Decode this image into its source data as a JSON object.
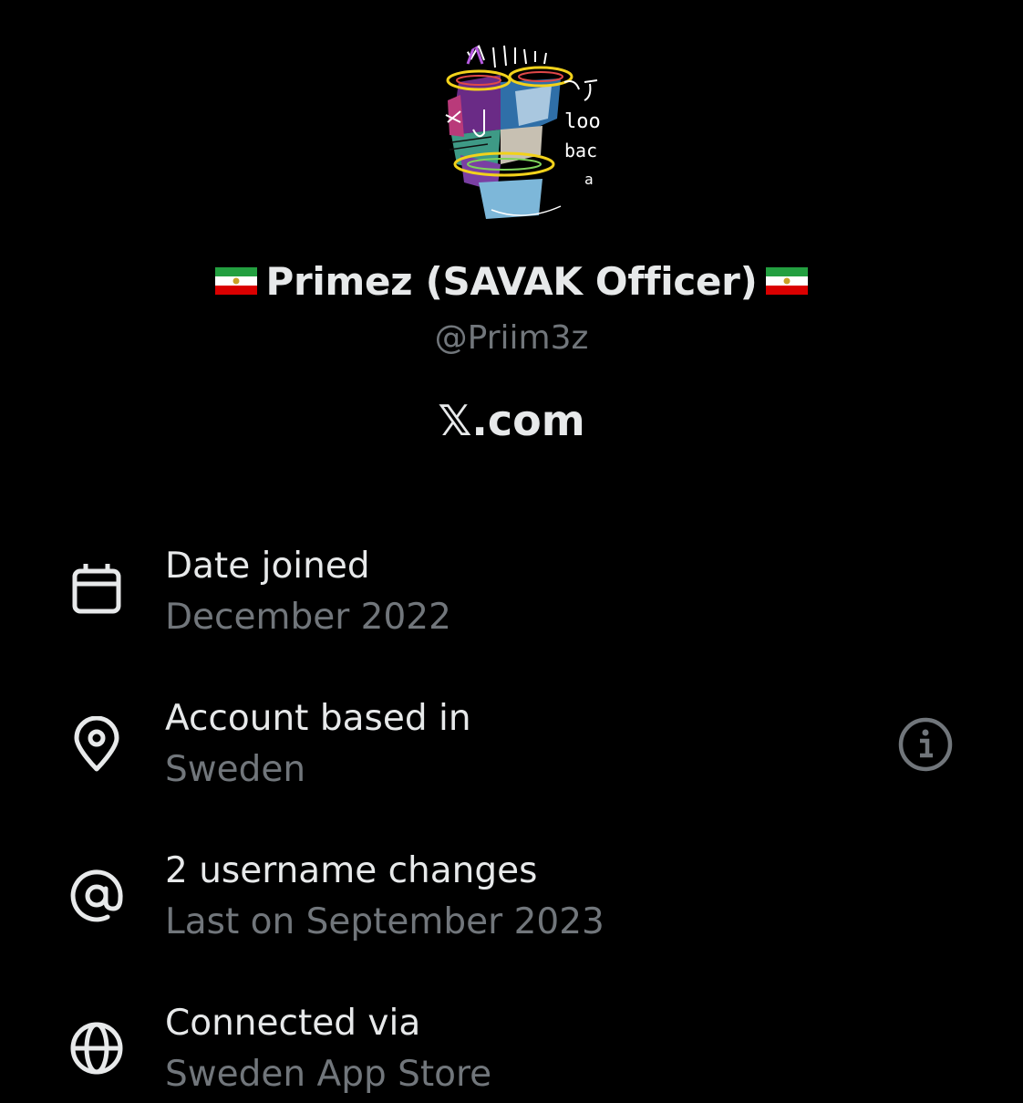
{
  "profile": {
    "display_name": "Primez (SAVAK Officer)",
    "handle": "@Priim3z",
    "site": "𝕏.com",
    "avatar_text": [
      "loo",
      "bac",
      "a"
    ]
  },
  "about": [
    {
      "icon": "calendar-icon",
      "title": "Date joined",
      "value": "December 2022"
    },
    {
      "icon": "location-pin-icon",
      "title": "Account based in",
      "value": "Sweden"
    },
    {
      "icon": "at-sign-icon",
      "title": "2 username changes",
      "value": "Last on September 2023"
    },
    {
      "icon": "globe-icon",
      "title": "Connected via",
      "value": "Sweden App Store"
    }
  ],
  "colors": {
    "background": "#000000",
    "primary_text": "#e7e9ea",
    "secondary_text": "#71767b",
    "flag_green": "#239f40",
    "flag_white": "#ffffff",
    "flag_red": "#da0000"
  }
}
